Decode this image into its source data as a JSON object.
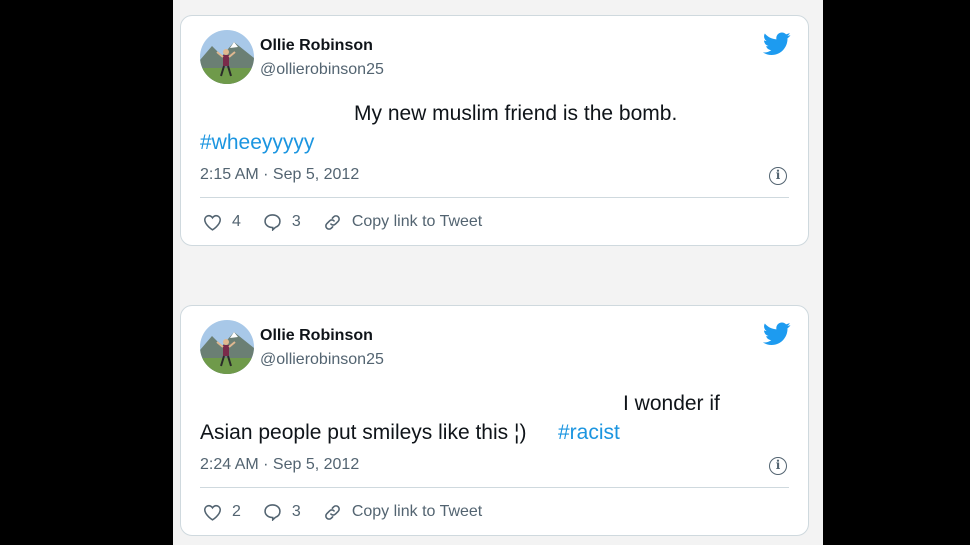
{
  "tweets": [
    {
      "name": "Ollie Robinson",
      "handle": "@ollierobinson25",
      "text_line1": "My new muslim friend is the bomb.",
      "hashtag": "#wheeyyyyy",
      "timestamp": "2:15 AM · Sep 5, 2012",
      "likes": "4",
      "replies": "3",
      "copy_link": "Copy link to Tweet"
    },
    {
      "name": "Ollie Robinson",
      "handle": "@ollierobinson25",
      "text_line1": "I wonder if",
      "text_line2": "Asian people put smileys like this ¦)",
      "hashtag": "#racist",
      "timestamp": "2:24 AM · Sep 5, 2012",
      "likes": "2",
      "replies": "3",
      "copy_link": "Copy link to Tweet"
    }
  ],
  "icons": {
    "brand": "twitter-bird-icon",
    "like": "heart-icon",
    "reply": "speech-bubble-icon",
    "link": "link-icon",
    "info": "info-icon"
  },
  "colors": {
    "brand_blue": "#1d9bf0",
    "hashtag_blue": "#1b95e0",
    "text_primary": "#0f1419",
    "text_secondary": "#536471"
  }
}
